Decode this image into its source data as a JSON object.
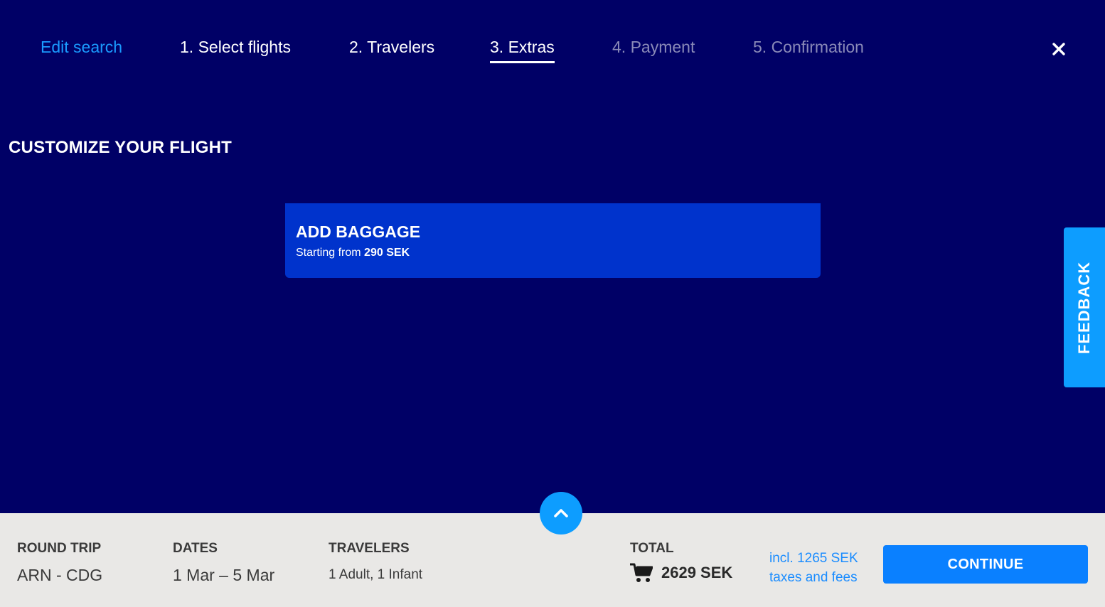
{
  "nav": {
    "edit_search": "Edit search",
    "steps": [
      {
        "label": "1. Select flights",
        "state": "done"
      },
      {
        "label": "2. Travelers",
        "state": "done"
      },
      {
        "label": "3. Extras",
        "state": "active"
      },
      {
        "label": "4. Payment",
        "state": "future"
      },
      {
        "label": "5. Confirmation",
        "state": "future"
      }
    ],
    "close_icon": "close-icon"
  },
  "page_title": "CUSTOMIZE YOUR FLIGHT",
  "baggage": {
    "title": "ADD BAGGAGE",
    "starting_from": "Starting from",
    "price": "290 SEK"
  },
  "feedback_label": "FEEDBACK",
  "expand_icon": "chevron-up-icon",
  "summary": {
    "trip_label": "ROUND TRIP",
    "trip_value": "ARN - CDG",
    "dates_label": "DATES",
    "dates_value": "1 Mar – 5 Mar",
    "travelers_label": "TRAVELERS",
    "travelers_value": "1 Adult, 1 Infant",
    "total_label": "TOTAL",
    "total_icon": "cart-icon",
    "total_value": "2629 SEK",
    "taxes_line1": "incl. 1265 SEK",
    "taxes_line2": "taxes and fees",
    "continue_label": "CONTINUE"
  },
  "colors": {
    "background": "#000066",
    "card": "#0033cc",
    "accent": "#0d9dff",
    "continue": "#0a80ff",
    "summary_bar": "#e9e8e6"
  }
}
